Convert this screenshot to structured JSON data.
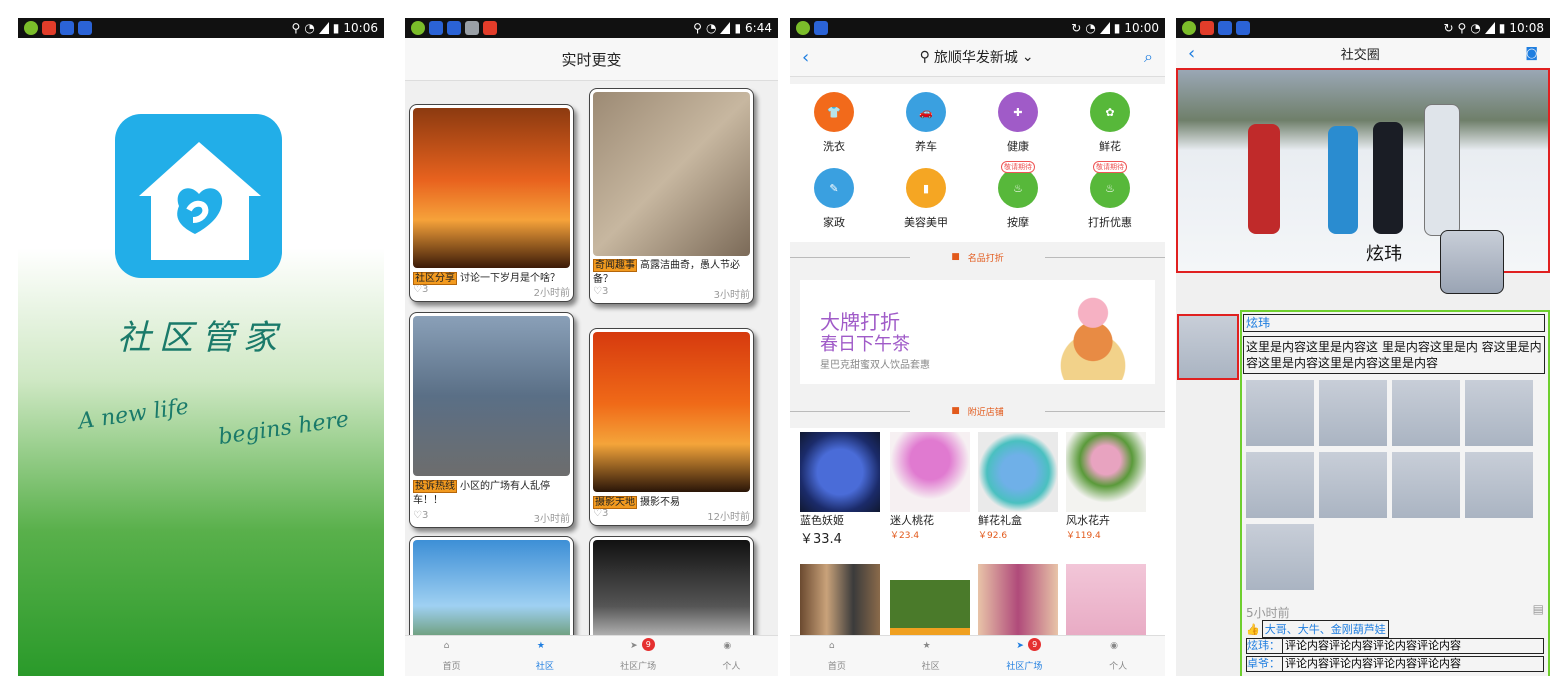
{
  "status_bars": [
    {
      "time": "10:06"
    },
    {
      "time": "6:44"
    },
    {
      "time": "10:00"
    },
    {
      "time": "10:08"
    }
  ],
  "splash": {
    "title": "社区管家",
    "line1": "A new life",
    "line2": "begins here",
    "brand_color": "#22aee8"
  },
  "feed": {
    "title": "实时更变",
    "cards": [
      {
        "tag": "社区分享",
        "text": "讨论一下岁月是个啥？",
        "likes": "3",
        "time": "2小时前"
      },
      {
        "tag": "奇闻趣事",
        "text": "高露洁曲奇，愚人节必备？",
        "likes": "3",
        "time": "3小时前"
      },
      {
        "tag": "投诉热线",
        "text": "小区的广场有人乱停车！！",
        "likes": "3",
        "time": "3小时前"
      },
      {
        "tag": "摄影天地",
        "text": "摄影不易",
        "likes": "3",
        "time": "12小时前"
      }
    ]
  },
  "tabbar": {
    "items": [
      "首页",
      "社区",
      "社区广场",
      "个人"
    ],
    "badge": "9",
    "active_color": "#1f7ee0"
  },
  "services": {
    "location": "旅顺华发新城",
    "categories": [
      {
        "label": "洗衣",
        "color": "#f26a1b",
        "badge": ""
      },
      {
        "label": "养车",
        "color": "#3aa0e0",
        "badge": ""
      },
      {
        "label": "健康",
        "color": "#a05bc8",
        "badge": ""
      },
      {
        "label": "鲜花",
        "color": "#57b83a",
        "badge": ""
      },
      {
        "label": "家政",
        "color": "#3aa0e0",
        "badge": ""
      },
      {
        "label": "美容美甲",
        "color": "#f5a623",
        "badge": ""
      },
      {
        "label": "按摩",
        "color": "#57b83a",
        "badge": "敬请期待"
      },
      {
        "label": "打折优惠",
        "color": "#57b83a",
        "badge": "敬请期待"
      }
    ],
    "section1": "名品打折",
    "banner": {
      "line1": "大牌打折",
      "line2": "春日下午茶",
      "line3": "星巴克甜蜜双人饮品套惠"
    },
    "section2": "附近店铺",
    "shops": [
      {
        "name": "蓝色妖姬",
        "price": "￥33.4"
      },
      {
        "name": "迷人桃花",
        "price": "￥23.4"
      },
      {
        "name": "鲜花礼盒",
        "price": "￥92.6"
      },
      {
        "name": "风水花卉",
        "price": "￥119.4"
      }
    ]
  },
  "social": {
    "title": "社交圈",
    "cover_name": "炫玮",
    "post": {
      "author": "炫玮",
      "content": "这里是内容这里是内容这 里是内容这里是内 容这里是内 容这里是内容这里是内容这里是内容",
      "time": "5小时前",
      "likes": "大哥、大牛、金刚葫芦娃",
      "comments": [
        {
          "user": "炫玮：",
          "text": "评论内容评论内容评论内容评论内容"
        },
        {
          "user": "卓爷：",
          "text": "评论内容评论内容评论内容评论内容"
        }
      ]
    }
  }
}
